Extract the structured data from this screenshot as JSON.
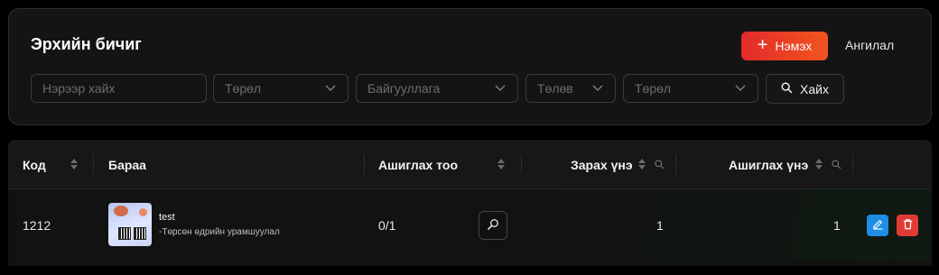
{
  "header": {
    "title": "Эрхийн бичиг",
    "add_label": "Нэмэх",
    "category_label": "Ангилал"
  },
  "filters": {
    "name_placeholder": "Нэрээр хайх",
    "type1_placeholder": "Төрөл",
    "organization_placeholder": "Байгууллага",
    "status_placeholder": "Төлөв",
    "type2_placeholder": "Төрөл",
    "search_label": "Хайх"
  },
  "table": {
    "columns": [
      "Код",
      "Бараа",
      "Ашиглах тоо",
      "Зарах үнэ",
      "Ашиглах үнэ"
    ],
    "rows": [
      {
        "code": "1212",
        "product_name": "test",
        "product_desc": "-Төрсөн өдрийн урамшуулал",
        "usage": "0/1",
        "sell_price": "1",
        "use_price": "1"
      }
    ]
  },
  "colors": {
    "accent_start": "#e32a2a",
    "accent_end": "#f0551f",
    "edit": "#1d8ee6",
    "delete": "#e23b35"
  },
  "icons": [
    "plus-icon",
    "chevron-down-icon",
    "search-icon",
    "sort-icon",
    "column-search-icon",
    "view-icon",
    "edit-icon",
    "trash-icon"
  ]
}
